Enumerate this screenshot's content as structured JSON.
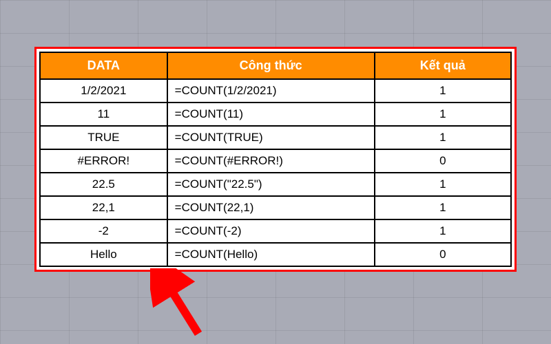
{
  "headers": {
    "data": "DATA",
    "formula": "Công thức",
    "result": "Kết quả"
  },
  "rows": [
    {
      "data": "1/2/2021",
      "formula": "=COUNT(1/2/2021)",
      "result": "1"
    },
    {
      "data": "11",
      "formula": "=COUNT(11)",
      "result": "1"
    },
    {
      "data": "TRUE",
      "formula": "=COUNT(TRUE)",
      "result": "1"
    },
    {
      "data": "#ERROR!",
      "formula": "=COUNT(#ERROR!)",
      "result": "0"
    },
    {
      "data": "22.5",
      "formula": "=COUNT(\"22.5\")",
      "result": "1"
    },
    {
      "data": "22,1",
      "formula": "=COUNT(22,1)",
      "result": "1"
    },
    {
      "data": "-2",
      "formula": "=COUNT(-2)",
      "result": "1"
    },
    {
      "data": "Hello",
      "formula": "=COUNT(Hello)",
      "result": "0"
    }
  ],
  "colors": {
    "header_bg": "#ff8c00",
    "frame_border": "#ff0000",
    "arrow": "#ff0000"
  },
  "chart_data": {
    "type": "table",
    "title": "COUNT function examples",
    "columns": [
      "DATA",
      "Công thức",
      "Kết quả"
    ],
    "rows": [
      [
        "1/2/2021",
        "=COUNT(1/2/2021)",
        1
      ],
      [
        "11",
        "=COUNT(11)",
        1
      ],
      [
        "TRUE",
        "=COUNT(TRUE)",
        1
      ],
      [
        "#ERROR!",
        "=COUNT(#ERROR!)",
        0
      ],
      [
        "22.5",
        "=COUNT(\"22.5\")",
        1
      ],
      [
        "22,1",
        "=COUNT(22,1)",
        1
      ],
      [
        "-2",
        "=COUNT(-2)",
        1
      ],
      [
        "Hello",
        "=COUNT(Hello)",
        0
      ]
    ]
  }
}
